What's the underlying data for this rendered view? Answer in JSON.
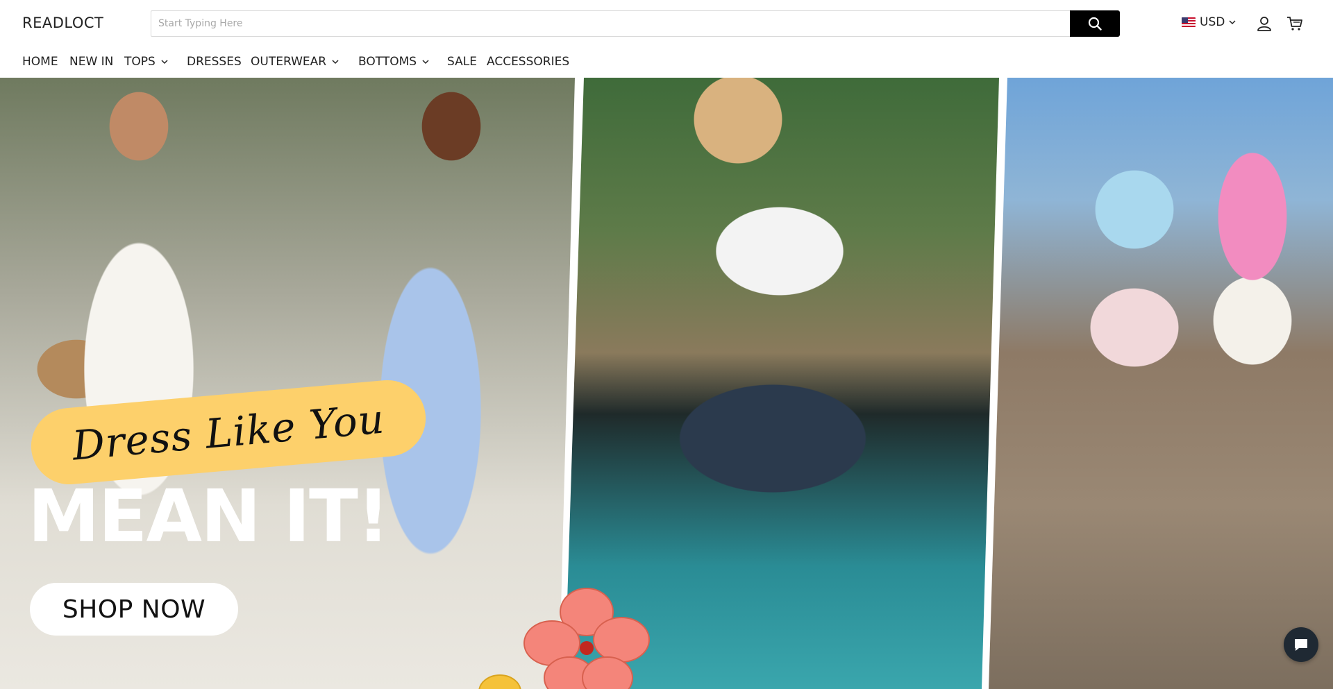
{
  "header": {
    "logo": "READLOCT",
    "search": {
      "placeholder": "Start Typing Here",
      "value": ""
    },
    "currency": "USD"
  },
  "nav": {
    "items": [
      {
        "label": "HOME",
        "has_dropdown": false
      },
      {
        "label": "NEW IN",
        "has_dropdown": false
      },
      {
        "label": "TOPS",
        "has_dropdown": true
      },
      {
        "label": "DRESSES",
        "has_dropdown": false
      },
      {
        "label": "OUTERWEAR",
        "has_dropdown": true
      },
      {
        "label": "BOTTOMS",
        "has_dropdown": true
      },
      {
        "label": "SALE",
        "has_dropdown": false
      },
      {
        "label": "ACCESSORIES",
        "has_dropdown": false
      }
    ]
  },
  "hero": {
    "tagline": "Dress Like You",
    "headline": "MEAN IT!",
    "cta_label": "SHOP NOW"
  },
  "colors": {
    "accent_yellow": "#fdd06b",
    "button_black": "#000000",
    "chat_dark": "#1f2933"
  },
  "icons": [
    "search-icon",
    "us-flag-icon",
    "chevron-down-icon",
    "account-icon",
    "cart-icon",
    "chat-icon"
  ]
}
